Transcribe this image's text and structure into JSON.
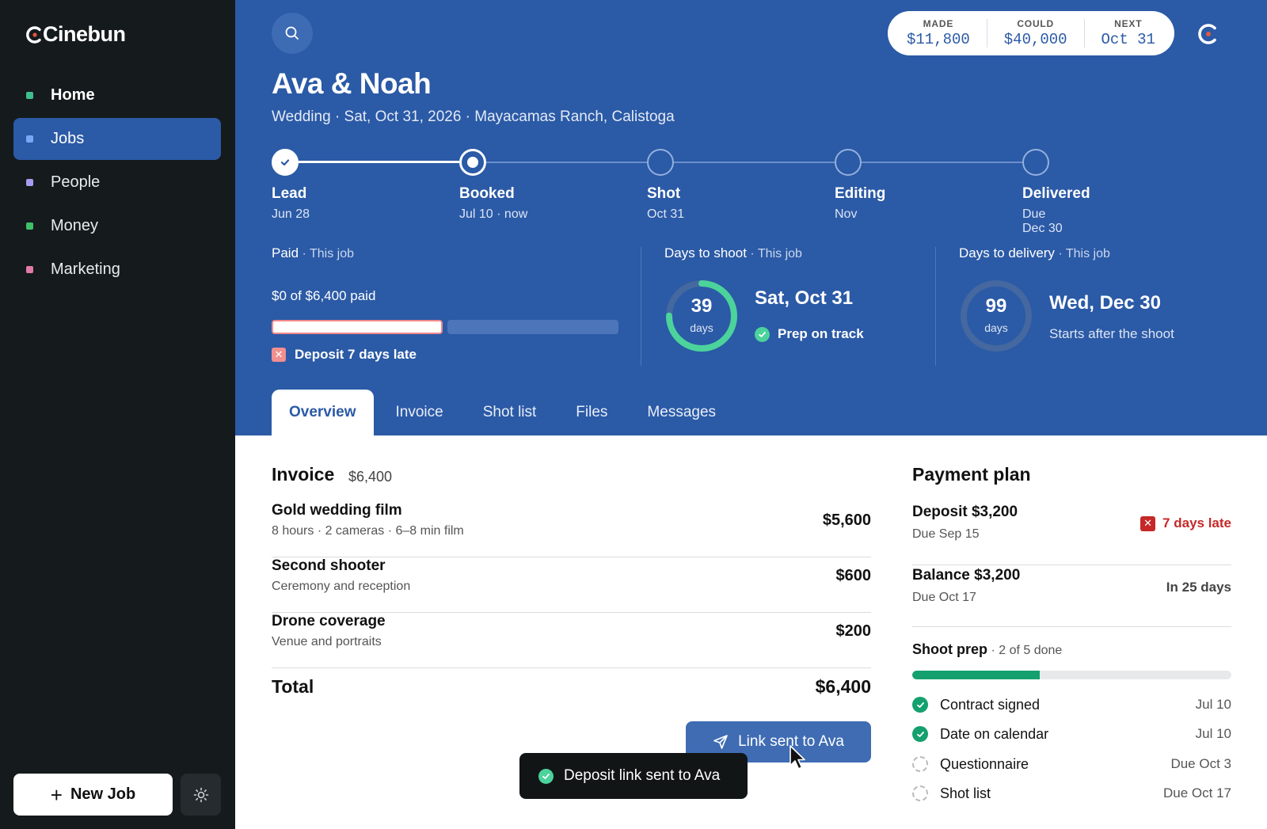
{
  "app": {
    "name": "Cinebun"
  },
  "sidebar": {
    "items": [
      {
        "label": "Home",
        "color": "#3fbf8f"
      },
      {
        "label": "Jobs",
        "color": "#6b9cf0"
      },
      {
        "label": "People",
        "color": "#a89cf0"
      },
      {
        "label": "Money",
        "color": "#3fbf6a"
      },
      {
        "label": "Marketing",
        "color": "#e07aa9"
      }
    ],
    "active": "Jobs",
    "new_job_label": "New Job"
  },
  "stats": {
    "made_label": "MADE",
    "made_value": "$11,800",
    "could_label": "COULD",
    "could_value": "$40,000",
    "next_label": "NEXT",
    "next_value": "Oct 31"
  },
  "job": {
    "title": "Ava & Noah",
    "subtitle": "Wedding · Sat, Oct 31, 2026 · Mayacamas Ranch, Calistoga"
  },
  "timeline": [
    {
      "label": "Lead",
      "date": "Jun 28",
      "state": "done"
    },
    {
      "label": "Booked",
      "date": "Jul 10 · now",
      "state": "current"
    },
    {
      "label": "Shot",
      "date": "Oct 31",
      "state": "todo"
    },
    {
      "label": "Editing",
      "date": "Nov",
      "state": "todo"
    },
    {
      "label": "Delivered",
      "date": "Due Dec 30",
      "state": "todo"
    }
  ],
  "paid": {
    "head": "Paid",
    "scope": "This job",
    "text": "$0 of $6,400 paid",
    "fraction": 0,
    "warning": "Deposit 7 days late"
  },
  "shoot": {
    "head": "Days to shoot",
    "scope": "This job",
    "days": "39",
    "unit": "days",
    "fraction": 0.75,
    "date": "Sat, Oct 31",
    "note": "Prep on track"
  },
  "delivery": {
    "head": "Days to delivery",
    "scope": "This job",
    "days": "99",
    "unit": "days",
    "fraction": 0,
    "date": "Wed, Dec 30",
    "note": "Starts after the shoot"
  },
  "tabs": [
    "Overview",
    "Invoice",
    "Shot list",
    "Files",
    "Messages"
  ],
  "active_tab": "Overview",
  "invoice": {
    "title": "Invoice",
    "amount": "$6,400",
    "items": [
      {
        "name": "Gold wedding film",
        "desc": "8 hours · 2 cameras · 6–8 min film",
        "amount": "$5,600"
      },
      {
        "name": "Second shooter",
        "desc": "Ceremony and reception",
        "amount": "$600"
      },
      {
        "name": "Drone coverage",
        "desc": "Venue and portraits",
        "amount": "$200"
      }
    ],
    "total_label": "Total",
    "total": "$6,400",
    "link_button": "Link sent to Ava"
  },
  "toast": {
    "text": "Deposit link sent to Ava"
  },
  "payment_plan": {
    "title": "Payment plan",
    "rows": [
      {
        "name": "Deposit $3,200",
        "due": "Due Sep 15",
        "status": "7 days late",
        "late": true
      },
      {
        "name": "Balance $3,200",
        "due": "Due Oct 17",
        "status": "In 25 days",
        "late": false
      }
    ]
  },
  "shoot_prep": {
    "head": "Shoot prep",
    "progress": "2 of 5 done",
    "fraction": 0.4,
    "items": [
      {
        "label": "Contract signed",
        "date": "Jul 10",
        "done": true
      },
      {
        "label": "Date on calendar",
        "date": "Jul 10",
        "done": true
      },
      {
        "label": "Questionnaire",
        "date": "Due Oct 3",
        "done": false
      },
      {
        "label": "Shot list",
        "date": "Due Oct 17",
        "done": false
      }
    ]
  },
  "colors": {
    "brand": "#2b5aa6",
    "sidebar": "#151a1c",
    "success": "#14a06f",
    "danger": "#c62828"
  }
}
